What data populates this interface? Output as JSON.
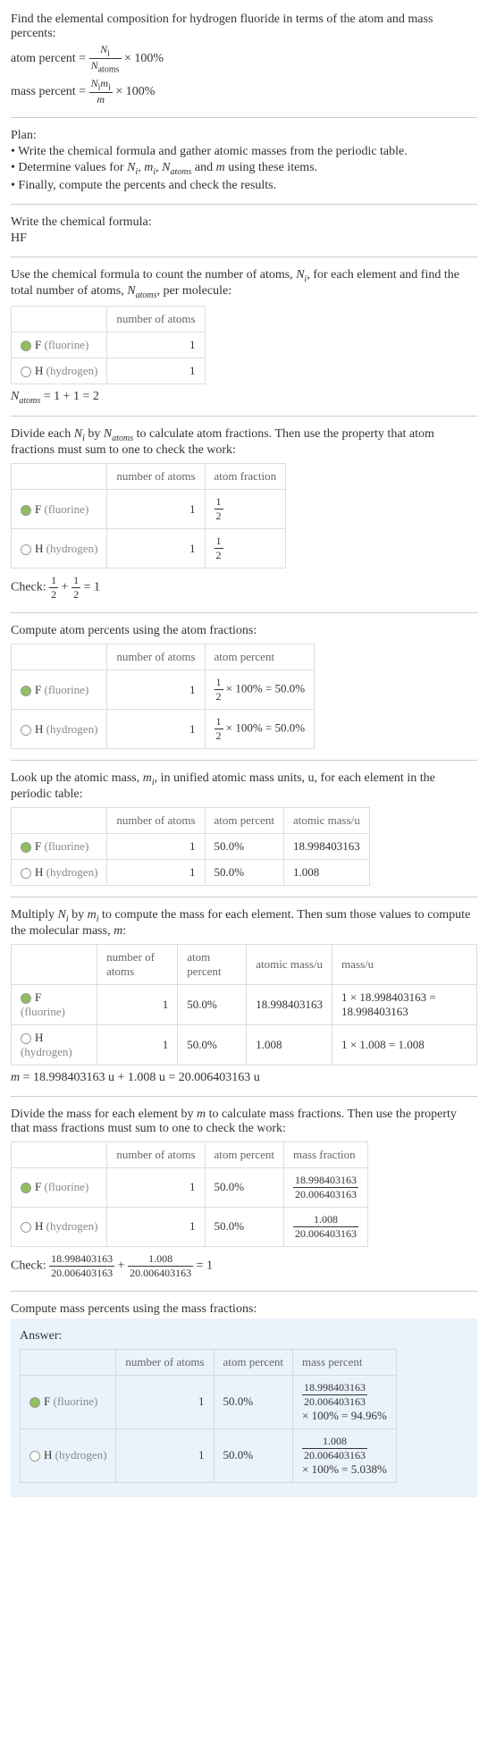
{
  "intro": {
    "line1": "Find the elemental composition for hydrogen fluoride in terms of the atom and mass percents:",
    "atom_percent_label": "atom percent = ",
    "atom_percent_formula_num": "N",
    "atom_percent_formula_num_sub": "i",
    "atom_percent_formula_den": "N",
    "atom_percent_formula_den_sub": "atoms",
    "times100": " × 100%",
    "mass_percent_label": "mass percent = ",
    "mass_percent_num": "N",
    "mass_percent_num_sub": "i",
    "mass_percent_num2": "m",
    "mass_percent_num2_sub": "i",
    "mass_percent_den": "m"
  },
  "plan": {
    "title": "Plan:",
    "b1": "• Write the chemical formula and gather atomic masses from the periodic table.",
    "b2_prefix": "• Determine values for ",
    "b2_suffix": " using these items.",
    "b3": "• Finally, compute the percents and check the results."
  },
  "write_formula": {
    "title": "Write the chemical formula:",
    "formula": "HF"
  },
  "count_atoms": {
    "text": "Use the chemical formula to count the number of atoms, ",
    "text2": ", for each element and find the total number of atoms, ",
    "text3": ", per molecule:",
    "col_atoms": "number of atoms",
    "row1_el": "F",
    "row1_name": "(fluorine)",
    "row1_n": "1",
    "row2_el": "H",
    "row2_name": "(hydrogen)",
    "row2_n": "1",
    "natoms_eq": " = 1 + 1 = 2"
  },
  "atom_fractions": {
    "text1": "Divide each ",
    "text2": " by ",
    "text3": " to calculate atom fractions. Then use the property that atom fractions must sum to one to check the work:",
    "col_atoms": "number of atoms",
    "col_frac": "atom fraction",
    "row1_n": "1",
    "row1_frac_num": "1",
    "row1_frac_den": "2",
    "row2_n": "1",
    "row2_frac_num": "1",
    "row2_frac_den": "2",
    "check_label": "Check: ",
    "check_eq": " = 1"
  },
  "atom_percents": {
    "text": "Compute atom percents using the atom fractions:",
    "col_atoms": "number of atoms",
    "col_pct": "atom percent",
    "row1_n": "1",
    "row1_pct": " × 100% = 50.0%",
    "row2_n": "1",
    "row2_pct": " × 100% = 50.0%"
  },
  "atomic_mass": {
    "text1": "Look up the atomic mass, ",
    "text2": ", in unified atomic mass units, u, for each element in the periodic table:",
    "col_atoms": "number of atoms",
    "col_pct": "atom percent",
    "col_mass": "atomic mass/u",
    "row1_n": "1",
    "row1_pct": "50.0%",
    "row1_mass": "18.998403163",
    "row2_n": "1",
    "row2_pct": "50.0%",
    "row2_mass": "1.008"
  },
  "mol_mass": {
    "text1": "Multiply ",
    "text2": " by ",
    "text3": " to compute the mass for each element. Then sum those values to compute the molecular mass, ",
    "text4": ":",
    "col_atoms": "number of atoms",
    "col_pct": "atom percent",
    "col_amass": "atomic mass/u",
    "col_mass": "mass/u",
    "row1_n": "1",
    "row1_pct": "50.0%",
    "row1_amass": "18.998403163",
    "row1_mass": "1 × 18.998403163 = 18.998403163",
    "row2_n": "1",
    "row2_pct": "50.0%",
    "row2_amass": "1.008",
    "row2_mass": "1 × 1.008 = 1.008",
    "m_eq": " = 18.998403163 u + 1.008 u = 20.006403163 u"
  },
  "mass_fractions": {
    "text": "Divide the mass for each element by m to calculate mass fractions. Then use the property that mass fractions must sum to one to check the work:",
    "col_atoms": "number of atoms",
    "col_pct": "atom percent",
    "col_mfrac": "mass fraction",
    "row1_n": "1",
    "row1_pct": "50.0%",
    "row1_num": "18.998403163",
    "row1_den": "20.006403163",
    "row2_n": "1",
    "row2_pct": "50.0%",
    "row2_num": "1.008",
    "row2_den": "20.006403163",
    "check_label": "Check: ",
    "check_eq": " = 1"
  },
  "final": {
    "text": "Compute mass percents using the mass fractions:",
    "answer_label": "Answer:",
    "col_atoms": "number of atoms",
    "col_pct": "atom percent",
    "col_mpct": "mass percent",
    "row1_n": "1",
    "row1_pct": "50.0%",
    "row1_num": "18.998403163",
    "row1_den": "20.006403163",
    "row1_res": "× 100% = 94.96%",
    "row2_n": "1",
    "row2_pct": "50.0%",
    "row2_num": "1.008",
    "row2_den": "20.006403163",
    "row2_res": "× 100% = 5.038%"
  },
  "elements": {
    "F": "F",
    "Fname": "(fluorine)",
    "H": "H",
    "Hname": "(hydrogen)"
  }
}
